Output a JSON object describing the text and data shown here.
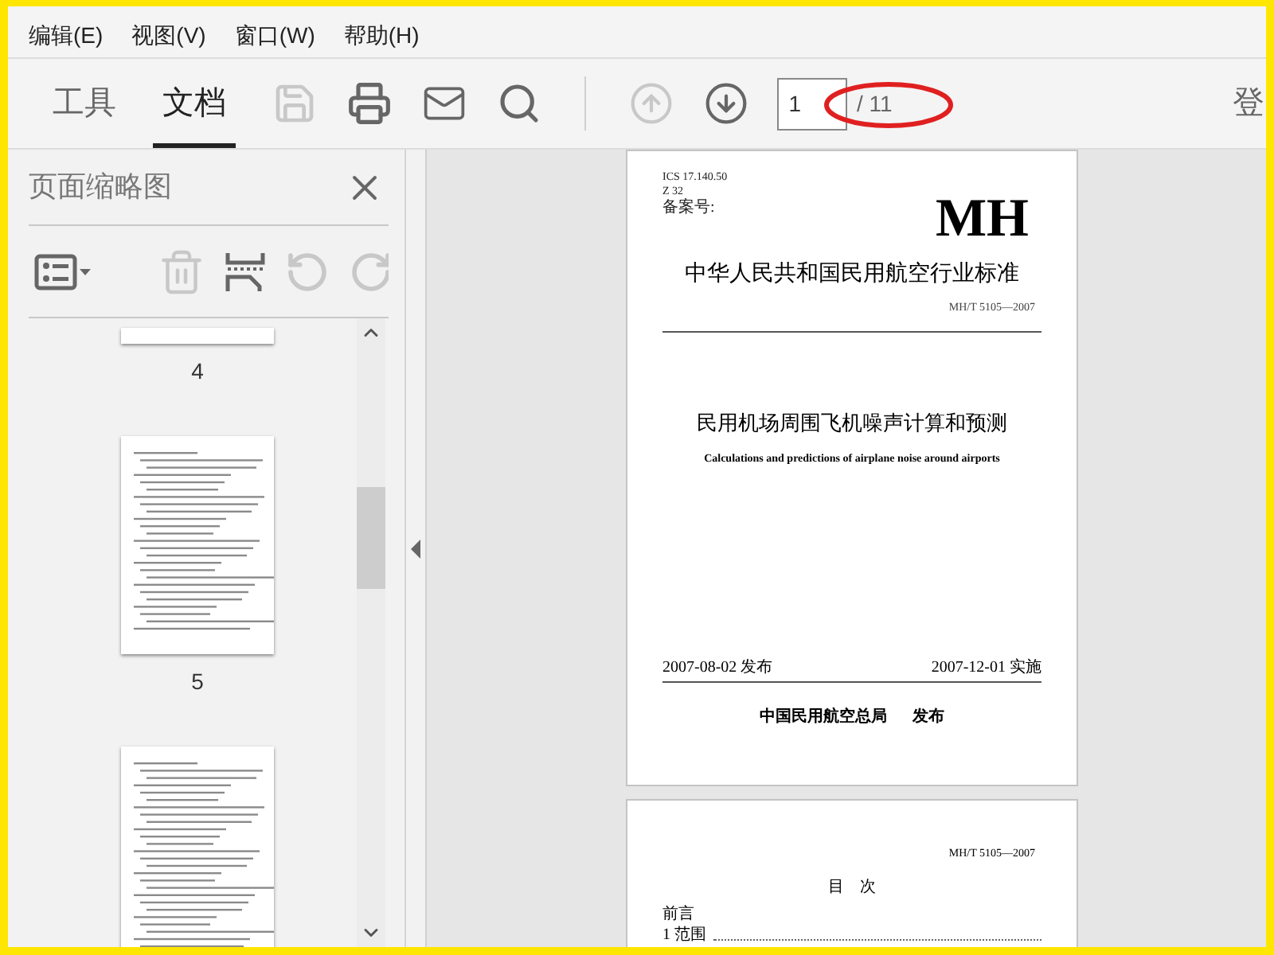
{
  "menu": [
    {
      "label": "编辑(E)"
    },
    {
      "label": "视图(V)"
    },
    {
      "label": "窗口(W)"
    },
    {
      "label": "帮助(H)"
    }
  ],
  "tabs": [
    {
      "label": "工具",
      "selected": false
    },
    {
      "label": "文档",
      "selected": true
    }
  ],
  "toolbar": [
    {
      "kind": "save",
      "disabled": true
    },
    {
      "kind": "print",
      "disabled": false
    },
    {
      "kind": "mail",
      "disabled": false
    },
    {
      "kind": "search",
      "disabled": false
    },
    {
      "kind": "separator"
    },
    {
      "kind": "previous",
      "disabled": true
    },
    {
      "kind": "next",
      "disabled": false
    }
  ],
  "page_field": {
    "value": "1",
    "total": "/ 11"
  },
  "sign_in": "登",
  "sidebar": {
    "title": "页面缩略图",
    "tools": [
      {
        "kind": "options",
        "disabled": false
      },
      {
        "kind": "separator"
      },
      {
        "kind": "delete",
        "disabled": true
      },
      {
        "kind": "insert",
        "disabled": false
      },
      {
        "kind": "undo",
        "disabled": true
      },
      {
        "kind": "redo",
        "disabled": true
      }
    ],
    "thumbnails": [
      {
        "kind": "tail",
        "label": "4"
      },
      {
        "kind": "page",
        "label": "5"
      },
      {
        "kind": "page"
      }
    ]
  },
  "pages": [
    {
      "kind": "cover",
      "meta": [
        "ICS 17.140.50",
        "Z 32",
        "备案号:"
      ],
      "logo": "MH",
      "standard": "中华人民共和国民用航空行业标准",
      "code": "MH/T 5105—2007",
      "title": "民用机场周围飞机噪声计算和预测",
      "subtitle": "Calculations and predictions of airplane noise around airports",
      "issued": "2007-08-02 发布",
      "effective": "2007-12-01 实施",
      "issuer": "中国民用航空总局",
      "issuer_action": "发布"
    },
    {
      "kind": "contents",
      "code": "MH/T 5105—2007",
      "heading": "目　次",
      "entries": [
        "前言",
        "1 范围"
      ]
    }
  ]
}
